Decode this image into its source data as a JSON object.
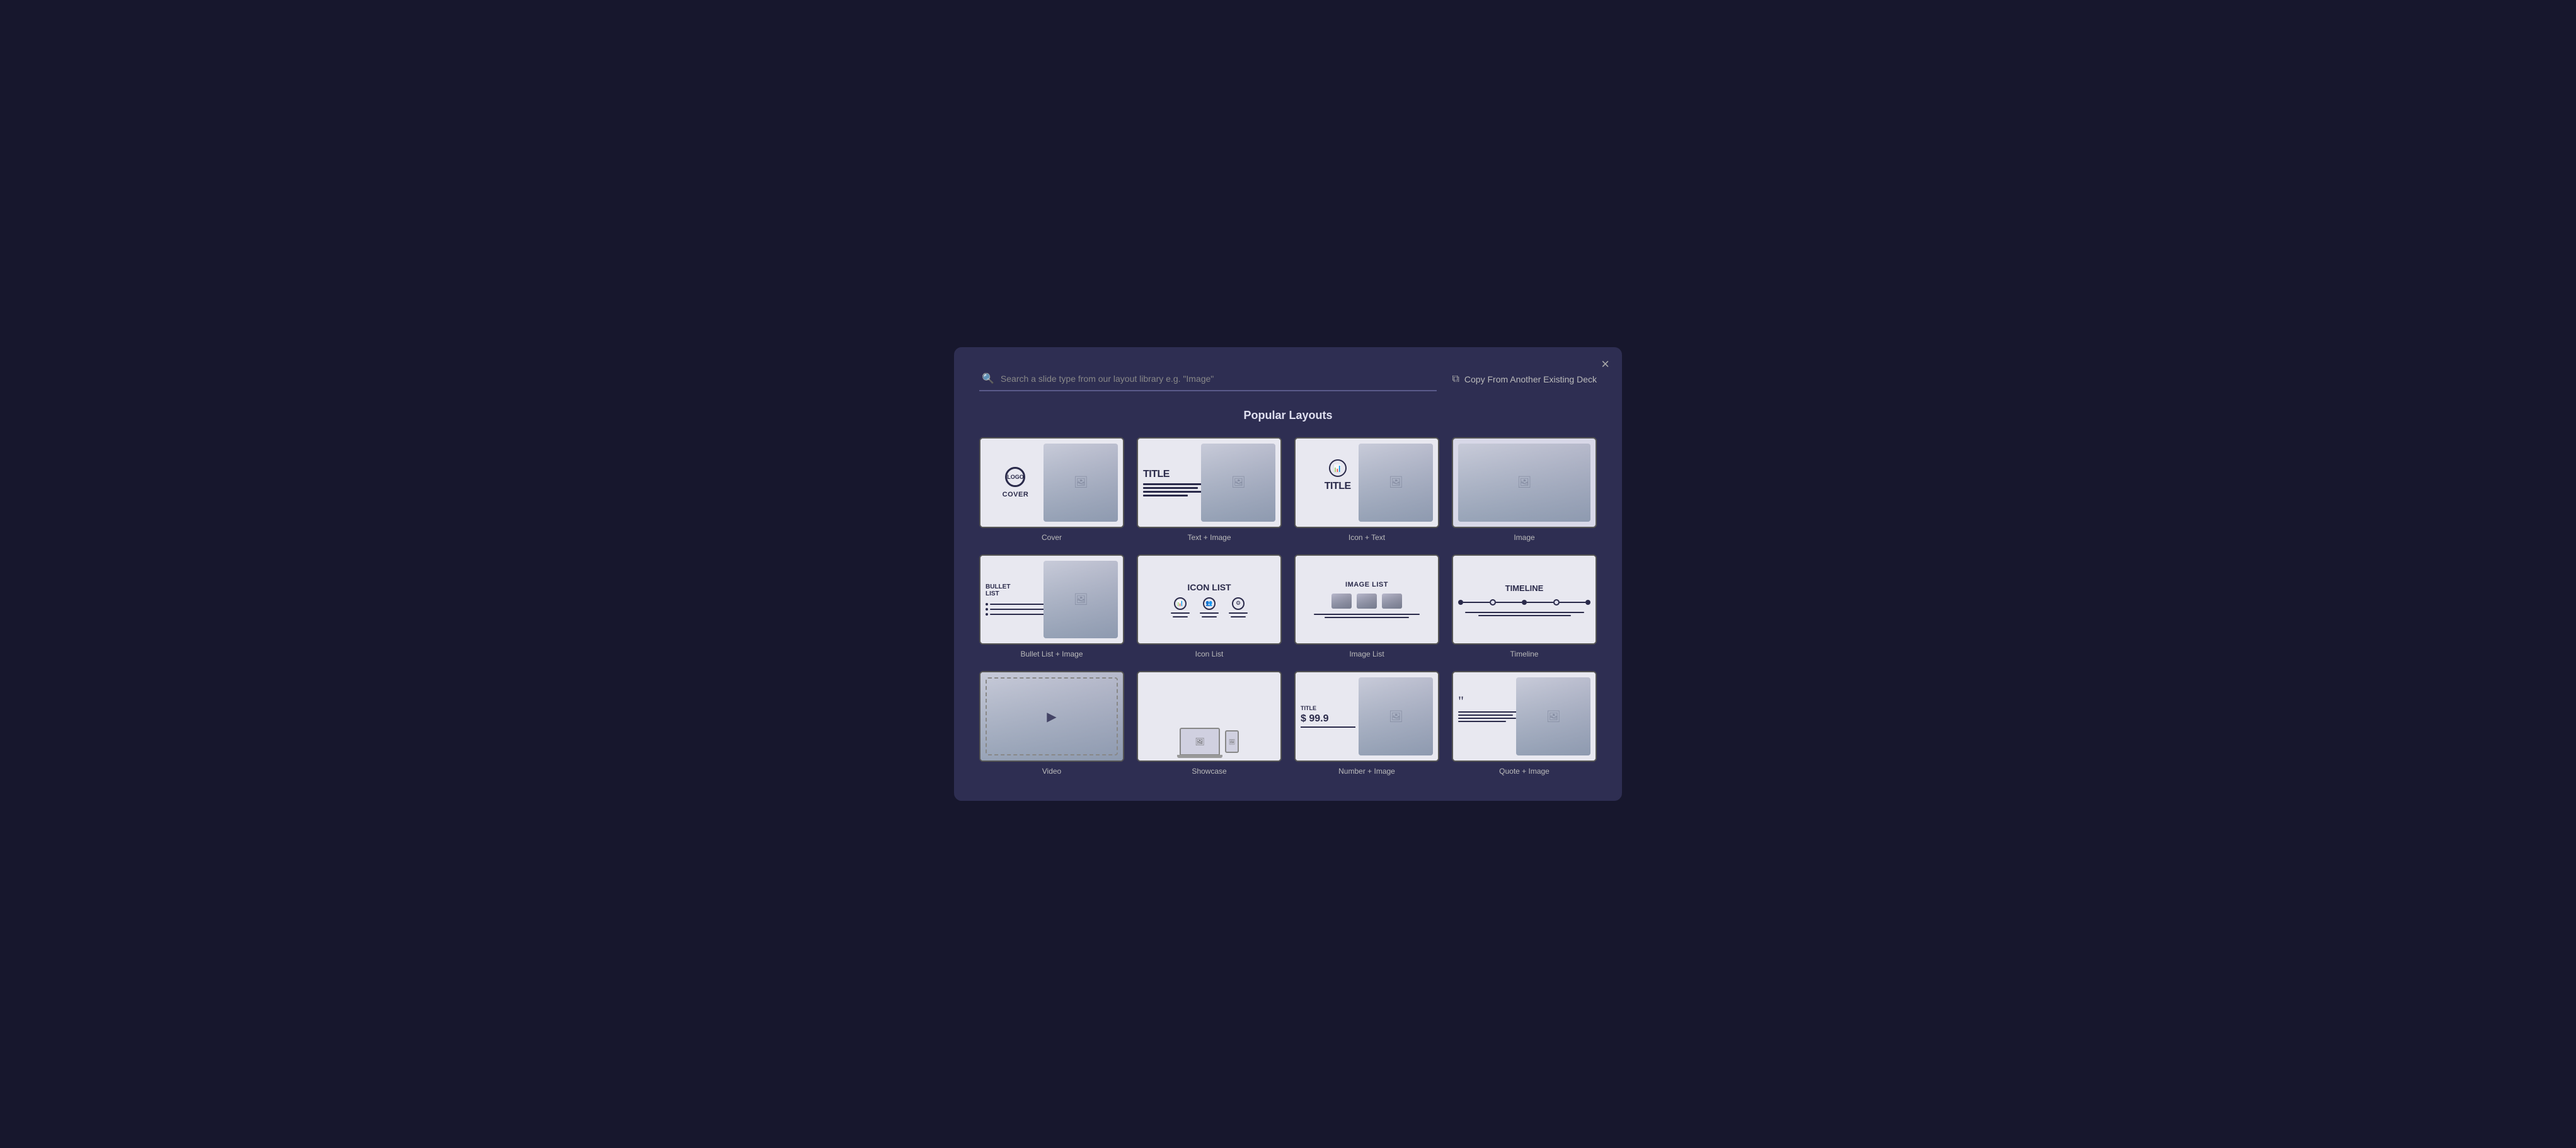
{
  "modal": {
    "title": "Popular Layouts",
    "search_placeholder": "Search a slide type from our layout library e.g. \"Image\"",
    "copy_from_label": "Copy From Another Existing Deck",
    "close_label": "×"
  },
  "layouts": [
    {
      "id": "cover",
      "label": "Cover",
      "type": "cover"
    },
    {
      "id": "text-image",
      "label": "Text + Image",
      "type": "text-image"
    },
    {
      "id": "icon-text",
      "label": "Icon + Text",
      "type": "icon-text"
    },
    {
      "id": "image",
      "label": "Image",
      "type": "image"
    },
    {
      "id": "bullet-list",
      "label": "Bullet List + Image",
      "type": "bullet-list"
    },
    {
      "id": "icon-list",
      "label": "Icon List",
      "type": "icon-list"
    },
    {
      "id": "image-list",
      "label": "Image List",
      "type": "image-list"
    },
    {
      "id": "timeline",
      "label": "Timeline",
      "type": "timeline"
    },
    {
      "id": "video",
      "label": "Video",
      "type": "video"
    },
    {
      "id": "showcase",
      "label": "Showcase",
      "type": "showcase"
    },
    {
      "id": "number-image",
      "label": "Number + Image",
      "type": "number-image"
    },
    {
      "id": "quote-image",
      "label": "Quote + Image",
      "type": "quote-image"
    }
  ],
  "thumb_texts": {
    "cover_logo": "LOGO",
    "cover_cover": "COVER",
    "title_text": "TITLE",
    "icon_text_title": "TITLE",
    "bullet_title": "BULLET LIST",
    "icon_list_title": "ICON LIST",
    "image_list_title": "IMAGE LIST",
    "timeline_title": "TIMELINE",
    "number_title": "TITLE",
    "number_value": "$ 99.9"
  }
}
